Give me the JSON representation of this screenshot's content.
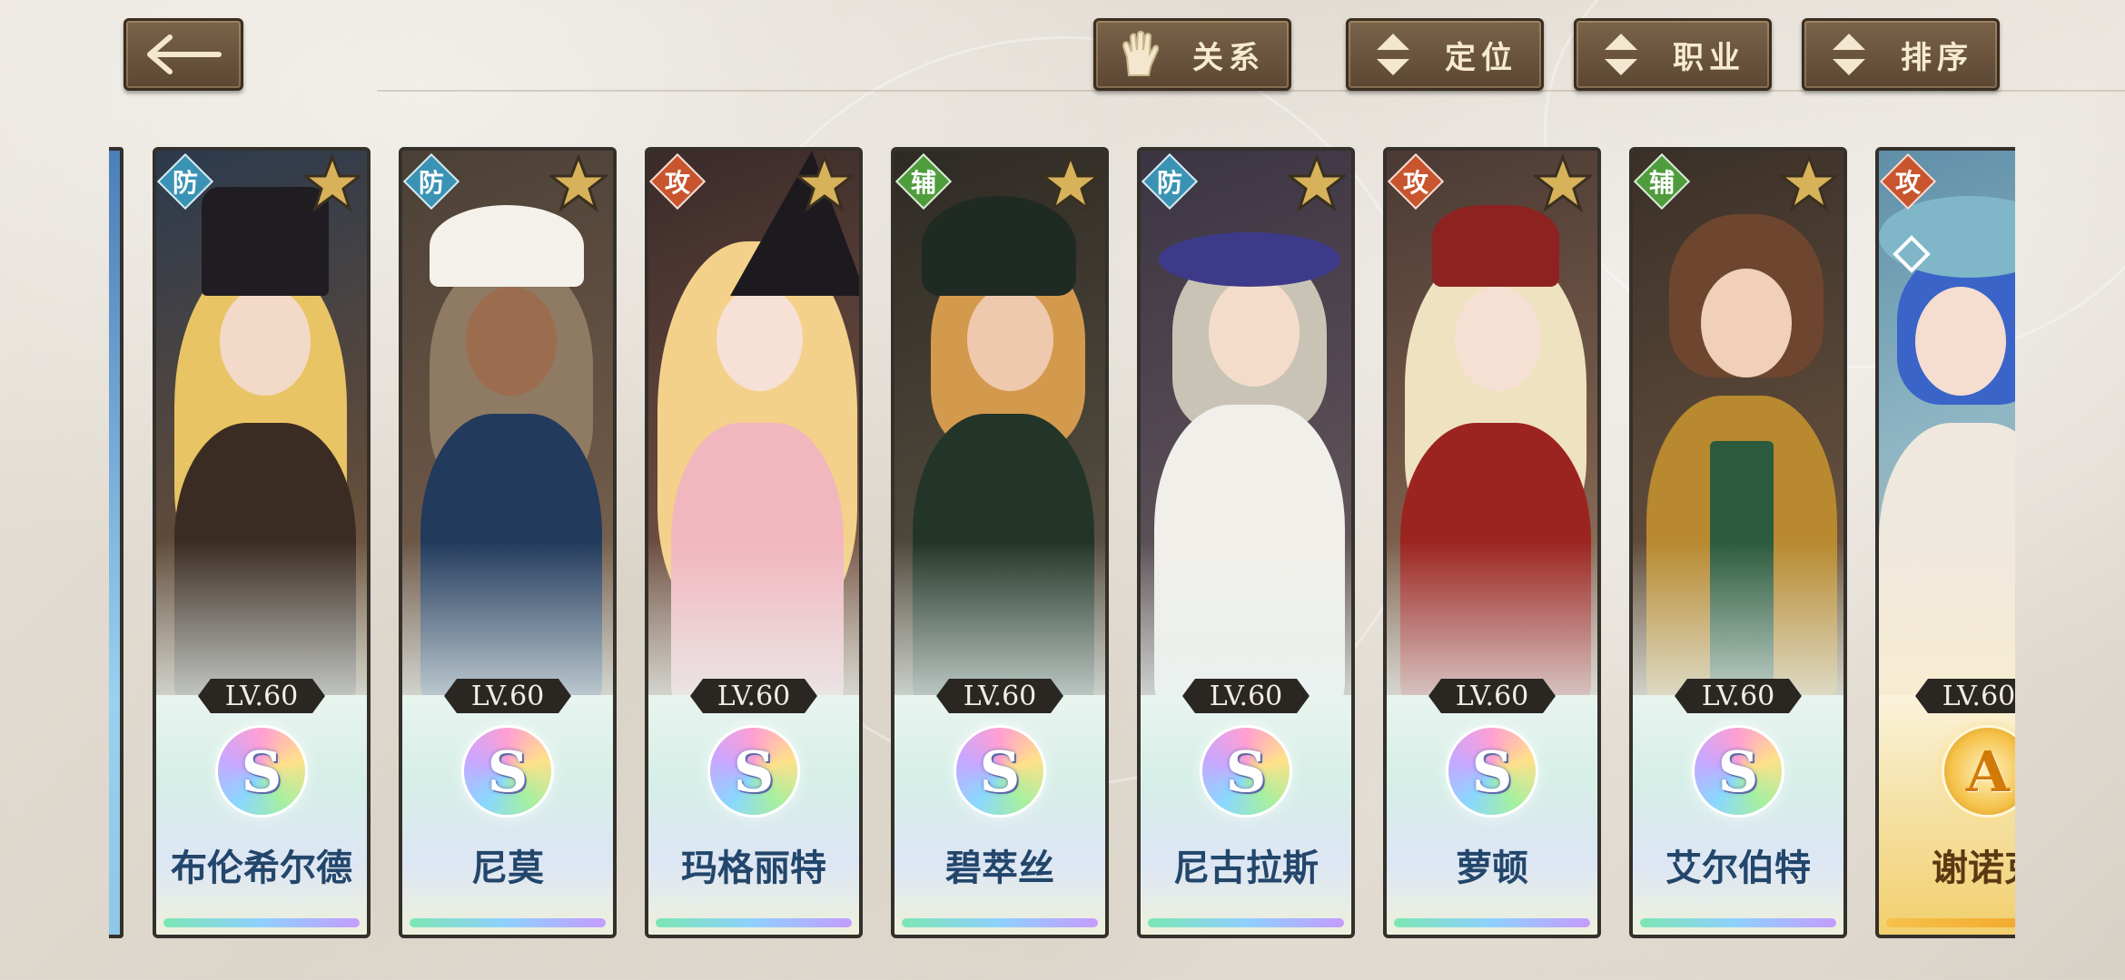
{
  "toolbar": {
    "back_icon": "arrow-left-icon",
    "relation": {
      "label": "关系",
      "icon": "glove-icon"
    },
    "position": {
      "label": "定位",
      "icon": "sort-arrows-icon"
    },
    "job": {
      "label": "职业",
      "icon": "sort-arrows-icon"
    },
    "sort": {
      "label": "排序",
      "icon": "sort-arrows-icon"
    }
  },
  "colors": {
    "defense": "#3a93b4",
    "attack": "#c8552e",
    "support": "#4f9c3d",
    "button_bg": "#6b543d"
  },
  "cards": [
    {
      "role": "防",
      "level": "LV.60",
      "grade": "S",
      "name": "布伦希尔德"
    },
    {
      "role": "防",
      "level": "LV.60",
      "grade": "S",
      "name": "尼莫"
    },
    {
      "role": "攻",
      "level": "LV.60",
      "grade": "S",
      "name": "玛格丽特"
    },
    {
      "role": "辅",
      "level": "LV.60",
      "grade": "S",
      "name": "碧萃丝"
    },
    {
      "role": "防",
      "level": "LV.60",
      "grade": "S",
      "name": "尼古拉斯"
    },
    {
      "role": "攻",
      "level": "LV.60",
      "grade": "S",
      "name": "萝顿"
    },
    {
      "role": "辅",
      "level": "LV.60",
      "grade": "S",
      "name": "艾尔伯特"
    },
    {
      "role": "攻",
      "level": "LV.60",
      "grade": "A",
      "name": "谢诺克"
    }
  ]
}
